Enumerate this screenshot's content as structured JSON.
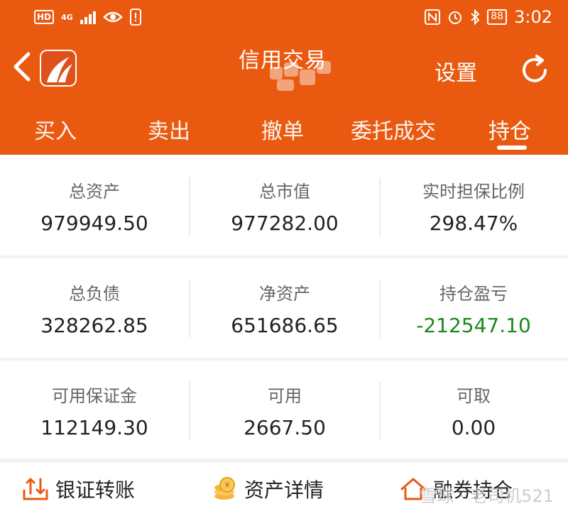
{
  "status_bar": {
    "hd": "HD",
    "network": "4G",
    "battery": "88",
    "time": "3:02"
  },
  "nav": {
    "title": "信用交易",
    "settings_label": "设置"
  },
  "tabs": [
    {
      "label": "买入"
    },
    {
      "label": "卖出"
    },
    {
      "label": "撤单"
    },
    {
      "label": "委托成交"
    },
    {
      "label": "持仓"
    }
  ],
  "summary": [
    [
      {
        "label": "总资产",
        "value": "979949.50"
      },
      {
        "label": "总市值",
        "value": "977282.00"
      },
      {
        "label": "实时担保比例",
        "value": "298.47%"
      }
    ],
    [
      {
        "label": "总负债",
        "value": "328262.85"
      },
      {
        "label": "净资产",
        "value": "651686.65"
      },
      {
        "label": "持仓盈亏",
        "value": "-212547.10"
      }
    ],
    [
      {
        "label": "可用保证金",
        "value": "112149.30"
      },
      {
        "label": "可用",
        "value": "2667.50"
      },
      {
        "label": "可取",
        "value": "0.00"
      }
    ]
  ],
  "bottom_actions": [
    {
      "label": "银证转账",
      "icon": "transfer-icon"
    },
    {
      "label": "资产详情",
      "icon": "coins-icon"
    },
    {
      "label": "融券持仓",
      "icon": "house-icon"
    }
  ],
  "watermark": "雪球 · 老司机521",
  "colors": {
    "brand": "#e95a10",
    "loss": "#1a8a1a"
  }
}
